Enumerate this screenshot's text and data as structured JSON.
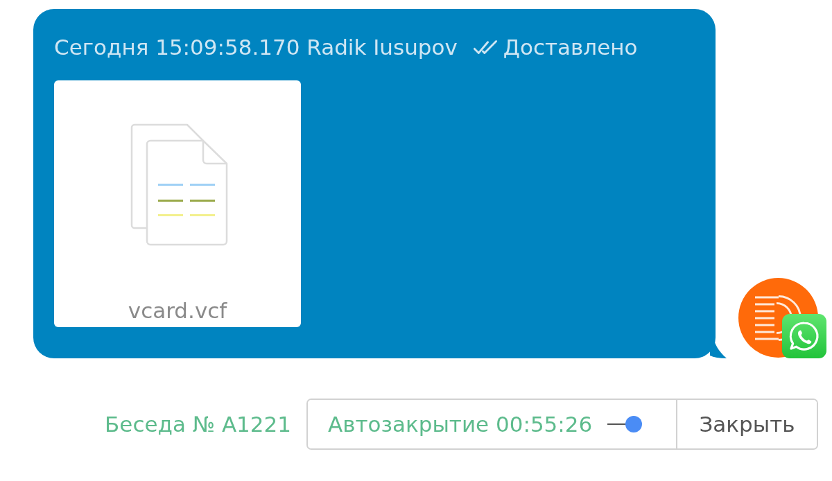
{
  "message": {
    "meta": "Сегодня 15:09:58.170 Radik Iusupov",
    "status": {
      "kind": "delivered",
      "label": "Доставлено"
    },
    "attachment": {
      "kind": "file",
      "file_name": "vcard.vcf"
    }
  },
  "footer": {
    "conversation": "Беседа № A1221",
    "autoclose": {
      "label": "Автозакрытие 00:55:26",
      "on": true
    },
    "close_button": "Закрыть"
  }
}
